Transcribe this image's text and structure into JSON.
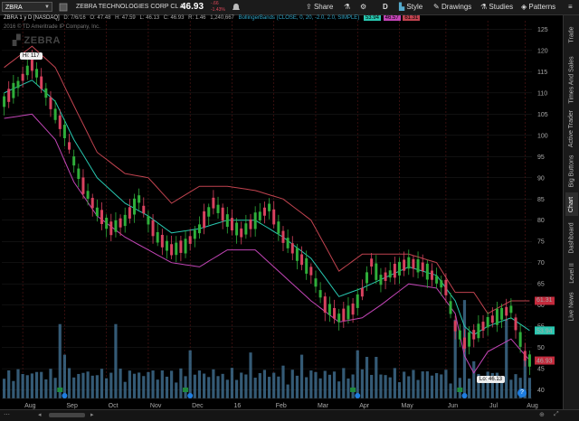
{
  "toolbar": {
    "symbol": "ZBRA",
    "company": "ZEBRA TECHNOLOGIES CORP CL A",
    "last": "46.93",
    "change": "-.66",
    "change_pct": "-1.43%",
    "share": "Share",
    "timeframe": "D",
    "style": "Style",
    "drawings": "Drawings",
    "studies": "Studies",
    "patterns": "Patterns"
  },
  "chart": {
    "header": "ZBRA 1 y D [NASDAQ]",
    "date": "D: 7/6/16",
    "open": "O: 47.48",
    "high": "H: 47.59",
    "low": "L: 46.13",
    "close": "C: 46.93",
    "range": "R: 1.46",
    "volume": "1,240,667",
    "study": "BollingerBands (CLOSE, 0, 20, -2.0, 2.0, SIMPLE)",
    "bb_mid": "53.94",
    "bb_low": "46.57",
    "bb_up": "61.31",
    "copyright": "2016 © TD Ameritrade IP Company, Inc.",
    "watermark": "ZEBRA",
    "hi_label": "Hi: 117",
    "lo_label": "Lo: 46.13",
    "help": "?"
  },
  "colors": {
    "up": "#2fae3a",
    "down": "#d9425f",
    "bb_mid": "#28c7b0",
    "bb_upper": "#c0434f",
    "bb_lower": "#c245b6",
    "volume": "#3d6a8a",
    "badge_red": "#c32a3c",
    "badge_green": "#1f8a3c",
    "badge_blue": "#1e7de0"
  },
  "chart_data": {
    "type": "candlestick",
    "x_labels": [
      "Aug",
      "Sep",
      "Oct",
      "Nov",
      "Dec",
      "16",
      "Feb",
      "Mar",
      "Apr",
      "May",
      "Jun",
      "Jul",
      "Aug"
    ],
    "y_ticks": [
      "125",
      "120",
      "115",
      "110",
      "105",
      "100",
      "95",
      "90",
      "85",
      "80",
      "75",
      "70",
      "65",
      "60",
      "55",
      "50",
      "45",
      "40"
    ],
    "ylim": [
      38,
      127
    ],
    "price_path": [
      [
        0,
        108
      ],
      [
        3,
        112
      ],
      [
        6,
        117
      ],
      [
        9,
        110
      ],
      [
        11,
        105
      ],
      [
        13,
        101
      ],
      [
        15,
        94
      ],
      [
        17,
        88
      ],
      [
        20,
        82
      ],
      [
        23,
        78
      ],
      [
        26,
        80
      ],
      [
        29,
        85
      ],
      [
        31,
        80
      ],
      [
        33,
        76
      ],
      [
        36,
        73
      ],
      [
        39,
        74
      ],
      [
        42,
        78
      ],
      [
        45,
        84
      ],
      [
        48,
        80
      ],
      [
        51,
        77
      ],
      [
        54,
        80
      ],
      [
        57,
        83
      ],
      [
        60,
        76
      ],
      [
        63,
        72
      ],
      [
        66,
        68
      ],
      [
        69,
        60
      ],
      [
        72,
        57
      ],
      [
        75,
        59
      ],
      [
        77,
        63
      ],
      [
        79,
        70
      ],
      [
        81,
        66
      ],
      [
        84,
        68
      ],
      [
        87,
        70
      ],
      [
        90,
        69
      ],
      [
        93,
        66
      ],
      [
        95,
        64
      ],
      [
        97,
        55
      ],
      [
        99,
        51
      ],
      [
        101,
        53
      ],
      [
        104,
        56
      ],
      [
        107,
        58
      ],
      [
        109,
        59
      ],
      [
        111,
        52
      ],
      [
        112,
        48
      ],
      [
        113,
        47
      ]
    ],
    "bb_up": [
      [
        0,
        116
      ],
      [
        6,
        121
      ],
      [
        11,
        116
      ],
      [
        15,
        107
      ],
      [
        20,
        96
      ],
      [
        26,
        91
      ],
      [
        31,
        90
      ],
      [
        36,
        84
      ],
      [
        42,
        88
      ],
      [
        48,
        88
      ],
      [
        54,
        87
      ],
      [
        60,
        85
      ],
      [
        66,
        80
      ],
      [
        72,
        68
      ],
      [
        77,
        72
      ],
      [
        81,
        72
      ],
      [
        87,
        72
      ],
      [
        93,
        70
      ],
      [
        97,
        63
      ],
      [
        99,
        63
      ],
      [
        101,
        63
      ],
      [
        104,
        58
      ],
      [
        109,
        61
      ],
      [
        113,
        61
      ]
    ],
    "bb_mid": [
      [
        0,
        110
      ],
      [
        6,
        113
      ],
      [
        11,
        108
      ],
      [
        15,
        99
      ],
      [
        20,
        90
      ],
      [
        26,
        84
      ],
      [
        31,
        81
      ],
      [
        36,
        77
      ],
      [
        42,
        78
      ],
      [
        48,
        80
      ],
      [
        54,
        80
      ],
      [
        60,
        76
      ],
      [
        66,
        71
      ],
      [
        72,
        62
      ],
      [
        77,
        64
      ],
      [
        81,
        66
      ],
      [
        87,
        69
      ],
      [
        93,
        67
      ],
      [
        97,
        61
      ],
      [
        99,
        55
      ],
      [
        101,
        53
      ],
      [
        104,
        55
      ],
      [
        109,
        57
      ],
      [
        113,
        54
      ]
    ],
    "bb_low": [
      [
        0,
        104
      ],
      [
        6,
        105
      ],
      [
        11,
        99
      ],
      [
        15,
        89
      ],
      [
        20,
        81
      ],
      [
        26,
        76
      ],
      [
        31,
        73
      ],
      [
        36,
        70
      ],
      [
        42,
        69
      ],
      [
        48,
        73
      ],
      [
        54,
        73
      ],
      [
        60,
        67
      ],
      [
        66,
        61
      ],
      [
        72,
        56
      ],
      [
        77,
        57
      ],
      [
        81,
        60
      ],
      [
        87,
        65
      ],
      [
        93,
        64
      ],
      [
        97,
        58
      ],
      [
        99,
        48
      ],
      [
        101,
        44
      ],
      [
        104,
        49
      ],
      [
        109,
        52
      ],
      [
        113,
        47
      ]
    ],
    "volume": [
      [
        12,
        0.34
      ],
      [
        13,
        0.2
      ],
      [
        24,
        0.34
      ],
      [
        40,
        0.22
      ],
      [
        53,
        0.21
      ],
      [
        60,
        0.15
      ],
      [
        64,
        0.2
      ],
      [
        76,
        0.22
      ],
      [
        78,
        0.19
      ],
      [
        80,
        0.19
      ],
      [
        97,
        0.36
      ],
      [
        99,
        0.45
      ],
      [
        101,
        0.17
      ],
      [
        108,
        0.36
      ],
      [
        112,
        0.18
      ]
    ],
    "n_bars": 114
  },
  "sidebar": {
    "tabs": [
      "Trade",
      "Times And Sales",
      "Active Trader",
      "Big Buttons",
      "Chart",
      "Dashboard",
      "Level II",
      "Live News"
    ],
    "active": "Chart"
  }
}
